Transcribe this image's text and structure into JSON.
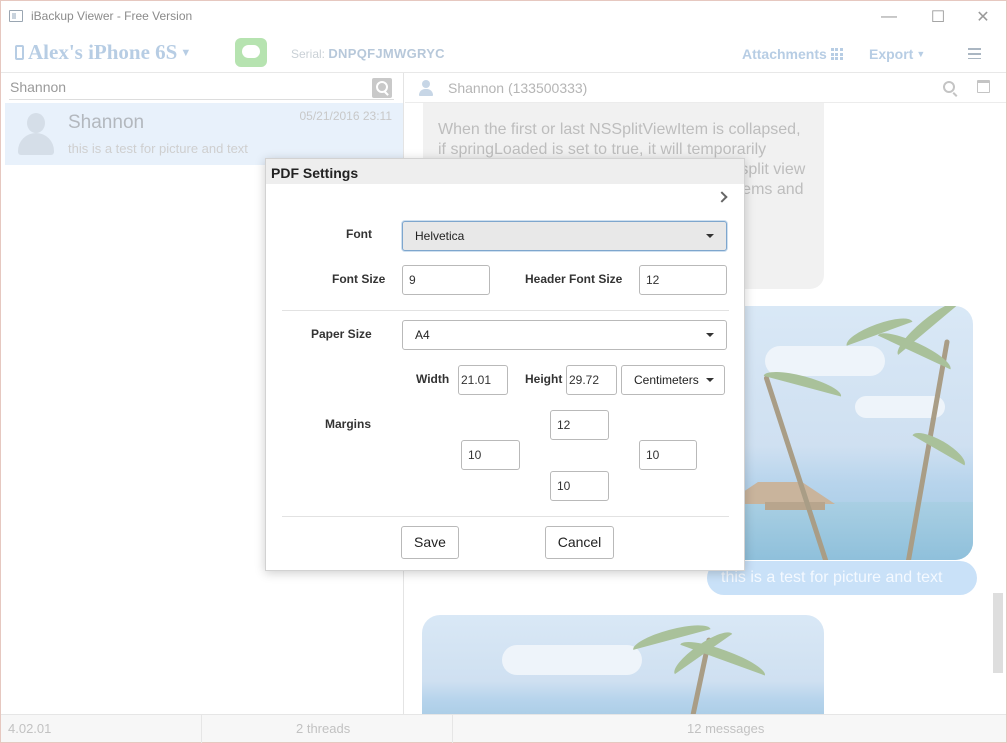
{
  "window": {
    "title": "iBackup Viewer - Free Version",
    "minimize": "—",
    "maximize": "☐",
    "close": "✕"
  },
  "toolbar": {
    "device_name": "Alex's iPhone 6S",
    "serial_label": "Serial:",
    "serial_value": "DNPQFJMWGRYC",
    "attachments_label": "Attachments",
    "export_label": "Export"
  },
  "sidebar": {
    "search_value": "Shannon",
    "threads": [
      {
        "name": "Shannon",
        "date": "05/21/2016 23:11",
        "preview": "this is a test for picture and text"
      }
    ]
  },
  "conversation": {
    "header": "Shannon (133500333)",
    "incoming_text": "When the first or last NSSplitViewItem is collapsed, if springLoaded is set to true, it will temporarily uncollapse when the split view when the e split view when the drag cursor the drag defaults to items and the bars.",
    "outgoing_text": "this is a test for picture and text"
  },
  "statusbar": {
    "version": "4.02.01",
    "threads": "2 threads",
    "messages": "12 messages"
  },
  "dialog": {
    "title": "PDF Settings",
    "font_label": "Font",
    "font_value": "Helvetica",
    "font_size_label": "Font Size",
    "font_size_value": "9",
    "header_font_size_label": "Header Font Size",
    "header_font_size_value": "12",
    "paper_size_label": "Paper Size",
    "paper_size_value": "A4",
    "width_label": "Width",
    "width_value": "21.01",
    "height_label": "Height",
    "height_value": "29.72",
    "unit_value": "Centimeters",
    "margins_label": "Margins",
    "margin_top": "12",
    "margin_left": "10",
    "margin_right": "10",
    "margin_bottom": "10",
    "save_label": "Save",
    "cancel_label": "Cancel"
  }
}
